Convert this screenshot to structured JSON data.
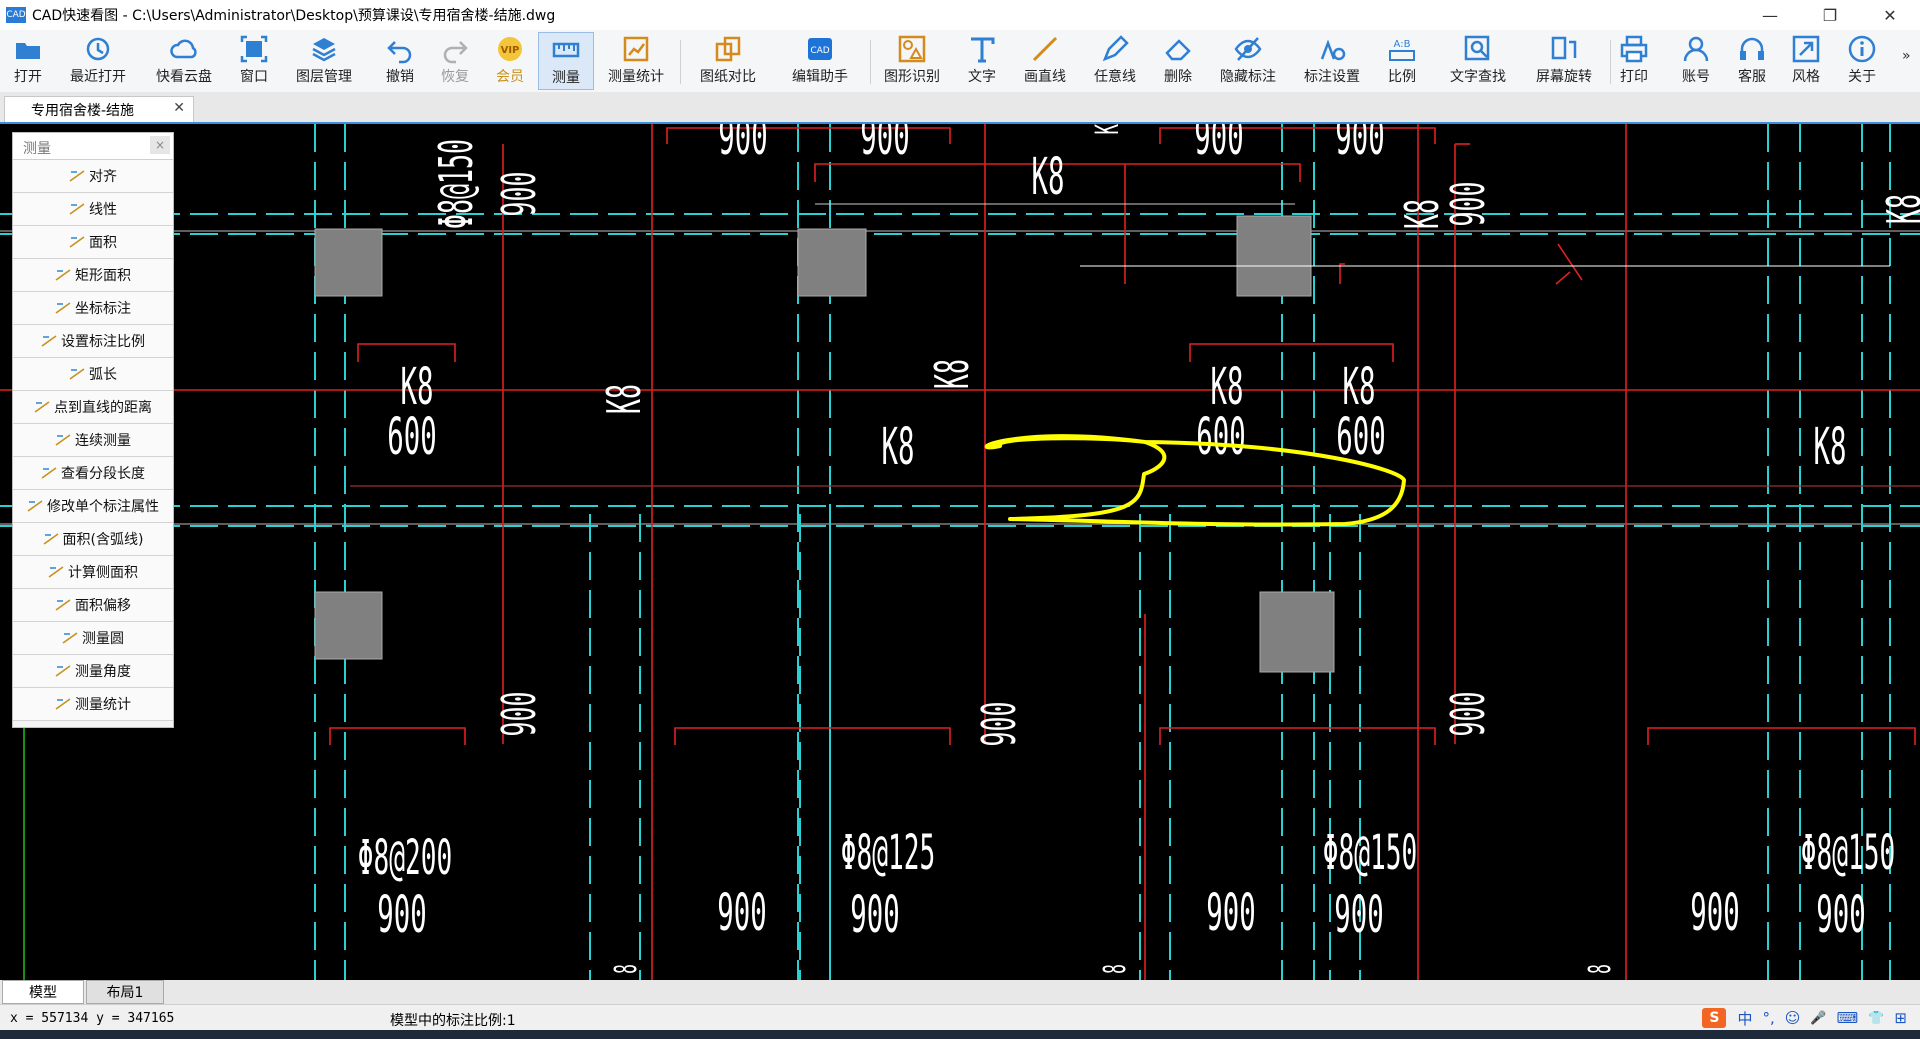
{
  "window": {
    "title": "CAD快速看图 - C:\\Users\\Administrator\\Desktop\\预算课设\\专用宿舍楼-结施.dwg",
    "logo_text": "CAD",
    "minimize": "—",
    "maximize": "❐",
    "close": "✕"
  },
  "toolbar": {
    "items": [
      {
        "label": "打开",
        "icon": "folder-open-icon"
      },
      {
        "label": "最近打开",
        "icon": "clock-history-icon"
      },
      {
        "label": "快看云盘",
        "icon": "cloud-icon"
      },
      {
        "label": "窗口",
        "icon": "window-frame-icon"
      },
      {
        "label": "图层管理",
        "icon": "layers-icon"
      },
      {
        "label": "撤销",
        "icon": "undo-icon"
      },
      {
        "label": "恢复",
        "icon": "redo-icon"
      },
      {
        "label": "会员",
        "icon": "vip-badge-icon"
      },
      {
        "label": "测量",
        "icon": "ruler-icon"
      },
      {
        "label": "测量统计",
        "icon": "measure-stats-icon"
      },
      {
        "label": "图纸对比",
        "icon": "compare-icon"
      },
      {
        "label": "编辑助手",
        "icon": "cad-edit-icon"
      },
      {
        "label": "图形识别",
        "icon": "shape-recognize-icon"
      },
      {
        "label": "文字",
        "icon": "text-t-icon"
      },
      {
        "label": "画直线",
        "icon": "line-icon"
      },
      {
        "label": "任意线",
        "icon": "pen-icon"
      },
      {
        "label": "删除",
        "icon": "eraser-icon"
      },
      {
        "label": "隐藏标注",
        "icon": "eye-hidden-icon"
      },
      {
        "label": "标注设置",
        "icon": "annotation-settings-icon"
      },
      {
        "label": "比例",
        "icon": "scale-ab-icon"
      },
      {
        "label": "文字查找",
        "icon": "text-search-icon"
      },
      {
        "label": "屏幕旋转",
        "icon": "rotate-screen-icon"
      },
      {
        "label": "打印",
        "icon": "printer-icon"
      },
      {
        "label": "账号",
        "icon": "user-icon"
      },
      {
        "label": "客服",
        "icon": "headset-icon"
      },
      {
        "label": "风格",
        "icon": "style-expand-icon"
      },
      {
        "label": "关于",
        "icon": "info-icon"
      }
    ],
    "overflow": "»"
  },
  "document_tab": {
    "label": "专用宿舍楼-结施",
    "close": "✕"
  },
  "measure_panel": {
    "title": "测量",
    "close": "×",
    "items": [
      {
        "label": "对齐"
      },
      {
        "label": "线性"
      },
      {
        "label": "面积"
      },
      {
        "label": "矩形面积"
      },
      {
        "label": "坐标标注"
      },
      {
        "label": "设置标注比例"
      },
      {
        "label": "弧长"
      },
      {
        "label": "点到直线的距离"
      },
      {
        "label": "连续测量"
      },
      {
        "label": "查看分段长度"
      },
      {
        "label": "修改单个标注属性"
      },
      {
        "label": "面积(含弧线)"
      },
      {
        "label": "计算侧面积"
      },
      {
        "label": "面积偏移"
      },
      {
        "label": "测量圆"
      },
      {
        "label": "测量角度"
      },
      {
        "label": "测量统计"
      }
    ]
  },
  "drawing": {
    "colors": {
      "background": "#000000",
      "axis": "#2bd1d1",
      "rebar": "#e02020",
      "text": "#ffffff",
      "column": "#808080",
      "highlight": "#ffff00"
    },
    "labels": {
      "k8": "K8",
      "dim600": "600",
      "dim900": "900",
      "phi150": "Φ8@150",
      "phi200": "Φ8@200",
      "phi125": "Φ8@125",
      "eight": "8"
    }
  },
  "layout_tabs": [
    {
      "label": "模型"
    },
    {
      "label": "布局1"
    }
  ],
  "status": {
    "coords": "x = 557134 y = 347165",
    "scale": "模型中的标注比例:1"
  },
  "tray": {
    "items": [
      "中",
      "°,",
      "☺",
      "🎤",
      "⌨",
      "👕",
      "⊞"
    ]
  }
}
